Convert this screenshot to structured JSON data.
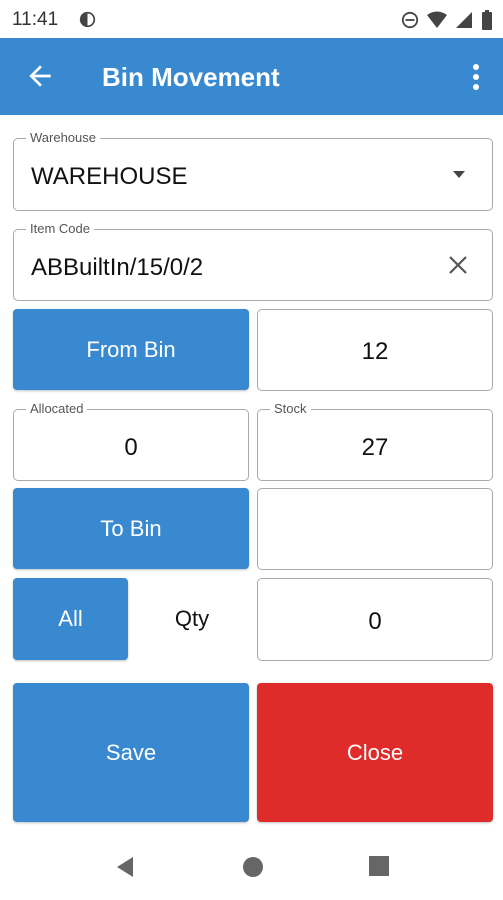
{
  "status_bar": {
    "time": "11:41",
    "icons": [
      "app-notification-icon",
      "do-not-disturb-icon",
      "wifi-icon",
      "signal-icon",
      "battery-icon"
    ]
  },
  "app_bar": {
    "title": "Bin Movement",
    "color": "#3889cf",
    "icons": [
      "back-arrow-icon",
      "more-vert-icon"
    ]
  },
  "form": {
    "warehouse": {
      "label": "Warehouse",
      "value": "WAREHOUSE",
      "icon": "dropdown-arrow-icon"
    },
    "item_code": {
      "label": "Item Code",
      "value": "ABBuiltIn/15/0/2",
      "icon": "clear-icon"
    },
    "from_bin": {
      "button_label": "From Bin",
      "value": "12"
    },
    "allocated": {
      "label": "Allocated",
      "value": "0"
    },
    "stock": {
      "label": "Stock",
      "value": "27"
    },
    "to_bin": {
      "button_label": "To Bin",
      "value": ""
    },
    "qty": {
      "all_label": "All",
      "label": "Qty",
      "value": "0"
    }
  },
  "actions": {
    "save_label": "Save",
    "close_label": "Close",
    "save_color": "#3889cf",
    "close_color": "#e02b2b"
  },
  "nav_bar": {
    "icons": [
      "nav-back-icon",
      "nav-home-icon",
      "nav-recents-icon"
    ]
  }
}
